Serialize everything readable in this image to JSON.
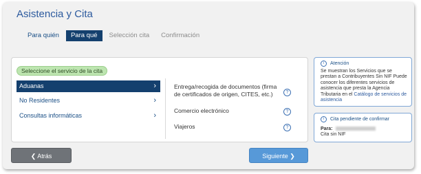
{
  "page": {
    "title": "Asistencia y Cita"
  },
  "tabs": [
    {
      "label": "Para quién",
      "state": "normal"
    },
    {
      "label": "Para qué",
      "state": "active"
    },
    {
      "label": "Selección cita",
      "state": "disabled"
    },
    {
      "label": "Confirmación",
      "state": "disabled"
    }
  ],
  "service": {
    "prompt": "Seleccione el servicio de la cita",
    "categories": [
      {
        "label": "Aduanas",
        "selected": true
      },
      {
        "label": "No Residentes",
        "selected": false
      },
      {
        "label": "Consultas informáticas",
        "selected": false
      }
    ],
    "options": [
      {
        "label": "Entrega/recogida de documentos (firma de certificados de origen, CITES, etc.)"
      },
      {
        "label": "Comercio electrónico"
      },
      {
        "label": "Viajeros"
      }
    ],
    "chevron": "›",
    "help_glyph": "?"
  },
  "nav": {
    "back_label": "❮ Atrás",
    "next_label": "Siguiente ❯"
  },
  "attention": {
    "title": "Atención",
    "text": "Se muestran los Servicios que se prestan a Contribuyentes Sin NIF Puede conocer los diferentes servicios de asistencia que presta la Agencia Tributaria en el",
    "link": "Catálogo de servicios de asistencia"
  },
  "pending": {
    "title": "Cita pendiente de confirmar",
    "para_label": "Para:",
    "subtitle": "Cita sin NIF"
  },
  "icons": {
    "info": "i"
  },
  "colors": {
    "primary_dark": "#14406e",
    "title_blue": "#2c5a9e",
    "success_green": "#bde5b0",
    "button_next": "#5799d8",
    "button_back": "#6f7378"
  }
}
